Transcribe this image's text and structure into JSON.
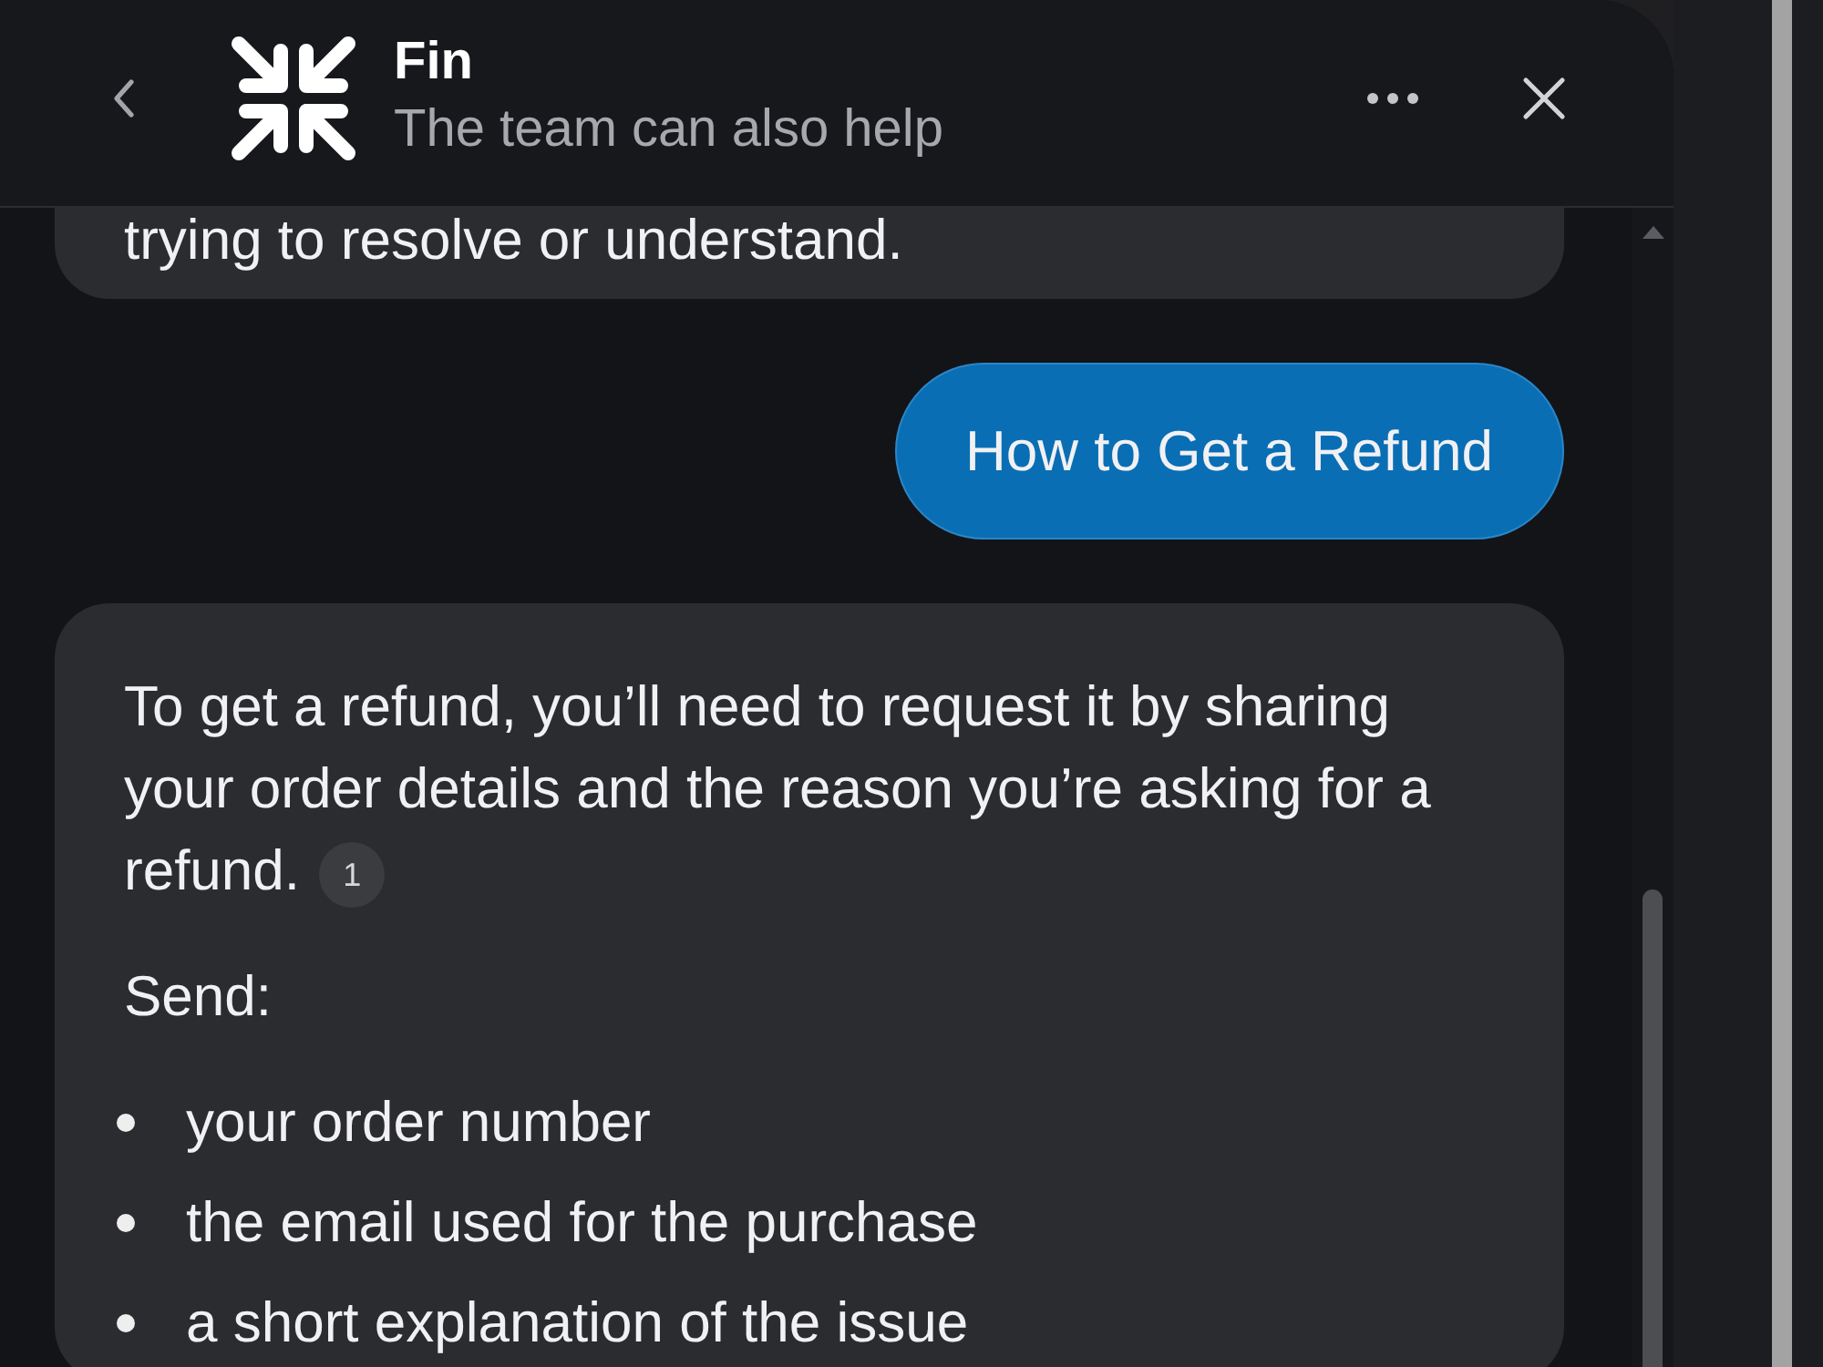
{
  "header": {
    "title": "Fin",
    "subtitle": "The team can also help"
  },
  "messages": [
    {
      "kind": "bot",
      "blocks": [
        {
          "kind": "paragraph",
          "text": "trying to resolve or understand."
        }
      ]
    },
    {
      "kind": "user",
      "blocks": [
        {
          "kind": "paragraph",
          "text": "How to Get a Refund"
        }
      ]
    },
    {
      "kind": "bot",
      "blocks": [
        {
          "kind": "paragraph",
          "text": "To get a refund, you’ll need to request it by sharing your order details and the reason you’re asking for a refund.",
          "citation": "1"
        },
        {
          "kind": "paragraph",
          "text": "Send:"
        },
        {
          "kind": "list",
          "items": [
            "your order number",
            "the email used for the purchase",
            "a short explanation of the issue"
          ]
        }
      ]
    }
  ]
}
